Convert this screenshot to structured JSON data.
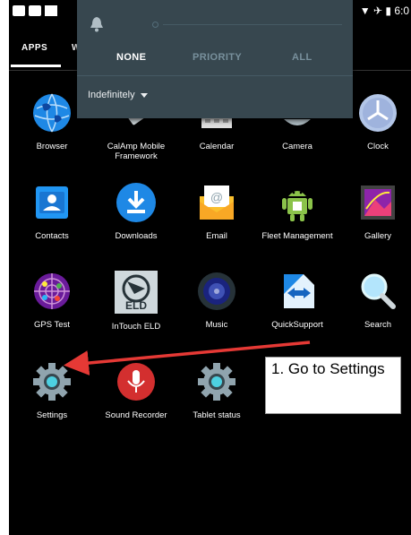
{
  "status_bar": {
    "time": "6:0"
  },
  "tabs": {
    "apps": "APPS",
    "widgets": "W"
  },
  "notification_panel": {
    "modes": [
      "NONE",
      "PRIORITY",
      "ALL"
    ],
    "selected_mode": "NONE",
    "duration": "Indefinitely"
  },
  "apps": [
    {
      "label": "Browser",
      "icon": "globe-icon"
    },
    {
      "label": "CalAmp Mobile Framework",
      "icon": "calamp-icon"
    },
    {
      "label": "Calendar",
      "icon": "calendar-icon"
    },
    {
      "label": "Camera",
      "icon": "camera-icon"
    },
    {
      "label": "Clock",
      "icon": "clock-icon"
    },
    {
      "label": "Contacts",
      "icon": "contacts-icon"
    },
    {
      "label": "Downloads",
      "icon": "download-icon"
    },
    {
      "label": "Email",
      "icon": "email-icon"
    },
    {
      "label": "Fleet Management",
      "icon": "android-icon"
    },
    {
      "label": "Gallery",
      "icon": "gallery-icon"
    },
    {
      "label": "GPS Test",
      "icon": "gps-icon"
    },
    {
      "label": "InTouch ELD",
      "icon": "eld-icon"
    },
    {
      "label": "Music",
      "icon": "music-icon"
    },
    {
      "label": "QuickSupport",
      "icon": "quicksupport-icon"
    },
    {
      "label": "Search",
      "icon": "search-icon"
    },
    {
      "label": "Settings",
      "icon": "gear-icon"
    },
    {
      "label": "Sound Recorder",
      "icon": "microphone-icon"
    },
    {
      "label": "Tablet status",
      "icon": "gear-icon"
    }
  ],
  "eld_badge": "ELD",
  "annotation": {
    "text": "1. Go to Settings",
    "arrow_color": "#e53935"
  }
}
